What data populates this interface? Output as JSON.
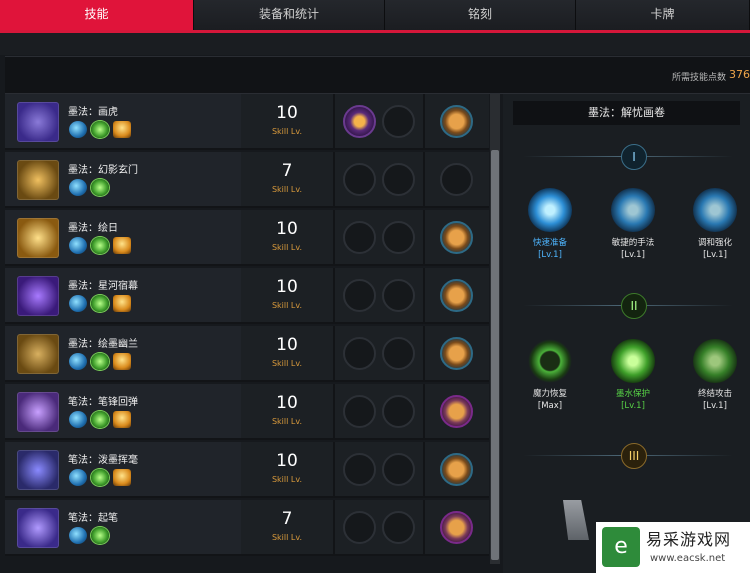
{
  "tabs": [
    {
      "label": "技能",
      "active": true
    },
    {
      "label": "装备和统计",
      "active": false
    },
    {
      "label": "铭刻",
      "active": false
    },
    {
      "label": "卡牌",
      "active": false
    }
  ],
  "skill_points": {
    "label": "所需技能点数",
    "value": "376"
  },
  "skills": [
    {
      "name": "墨法：画虎",
      "level": "10",
      "level_label": "Skill Lv.",
      "runes": [
        "blue",
        "green",
        "gold"
      ],
      "gem1": "purple",
      "gem2": "empty",
      "card": "gold",
      "icon_colors": [
        "#3a2a8a",
        "#8a7ad8"
      ]
    },
    {
      "name": "墨法：幻影玄门",
      "level": "7",
      "level_label": "Skill Lv.",
      "runes": [
        "blue",
        "green"
      ],
      "gem1": "empty",
      "gem2": "empty",
      "card": "empty",
      "icon_colors": [
        "#6a4a12",
        "#f0c060"
      ]
    },
    {
      "name": "墨法：绘日",
      "level": "10",
      "level_label": "Skill Lv.",
      "runes": [
        "blue",
        "green",
        "gold"
      ],
      "gem1": "empty",
      "gem2": "empty",
      "card": "gold",
      "icon_colors": [
        "#8a5a10",
        "#ffe08a"
      ]
    },
    {
      "name": "墨法：星河宿幕",
      "level": "10",
      "level_label": "Skill Lv.",
      "runes": [
        "blue",
        "green",
        "gold"
      ],
      "gem1": "empty",
      "gem2": "empty",
      "card": "gold",
      "icon_colors": [
        "#3a1a7a",
        "#a87aff"
      ]
    },
    {
      "name": "墨法：绘墨幽兰",
      "level": "10",
      "level_label": "Skill Lv.",
      "runes": [
        "blue",
        "green",
        "gold"
      ],
      "gem1": "empty",
      "gem2": "empty",
      "card": "gold",
      "icon_colors": [
        "#6a4a12",
        "#d8b060"
      ]
    },
    {
      "name": "笔法：笔锋回弹",
      "level": "10",
      "level_label": "Skill Lv.",
      "runes": [
        "blue",
        "green",
        "gold"
      ],
      "gem1": "empty",
      "gem2": "empty",
      "card": "violet",
      "icon_colors": [
        "#4a2a7a",
        "#c8a0ff"
      ]
    },
    {
      "name": "笔法：泼墨挥毫",
      "level": "10",
      "level_label": "Skill Lv.",
      "runes": [
        "blue",
        "green",
        "gold"
      ],
      "gem1": "empty",
      "gem2": "empty",
      "card": "gold",
      "icon_colors": [
        "#2a2a6a",
        "#8a8aff"
      ]
    },
    {
      "name": "笔法：起笔",
      "level": "7",
      "level_label": "Skill Lv.",
      "runes": [
        "blue",
        "green"
      ],
      "gem1": "empty",
      "gem2": "empty",
      "card": "violet",
      "icon_colors": [
        "#3a2a8a",
        "#b09aff"
      ]
    }
  ],
  "tripod_panel": {
    "title": "墨法：解忧画卷",
    "tiers": [
      {
        "numeral": "I",
        "nodes": [
          {
            "label": "快速准备",
            "level": "[Lv.1]",
            "selected": true
          },
          {
            "label": "敏捷的手法",
            "level": "[Lv.1]",
            "selected": false
          },
          {
            "label": "调和强化",
            "level": "[Lv.1]",
            "selected": false
          }
        ]
      },
      {
        "numeral": "II",
        "nodes": [
          {
            "label": "魔力恢复",
            "level": "[Max]",
            "selected": false
          },
          {
            "label": "墨水保护",
            "level": "[Lv.1]",
            "selected": true
          },
          {
            "label": "终结攻击",
            "level": "[Lv.1]",
            "selected": false
          }
        ]
      },
      {
        "numeral": "III",
        "nodes": []
      }
    ]
  },
  "watermark": {
    "logo_char": "e",
    "text": "易采游戏网",
    "url": "www.eacsk.net"
  },
  "colors": {
    "accent": "#e0143a",
    "level_label": "#d99a3c",
    "tier1": "#4fb6ff",
    "tier2": "#57d146",
    "tier3": "#f7d16a"
  }
}
